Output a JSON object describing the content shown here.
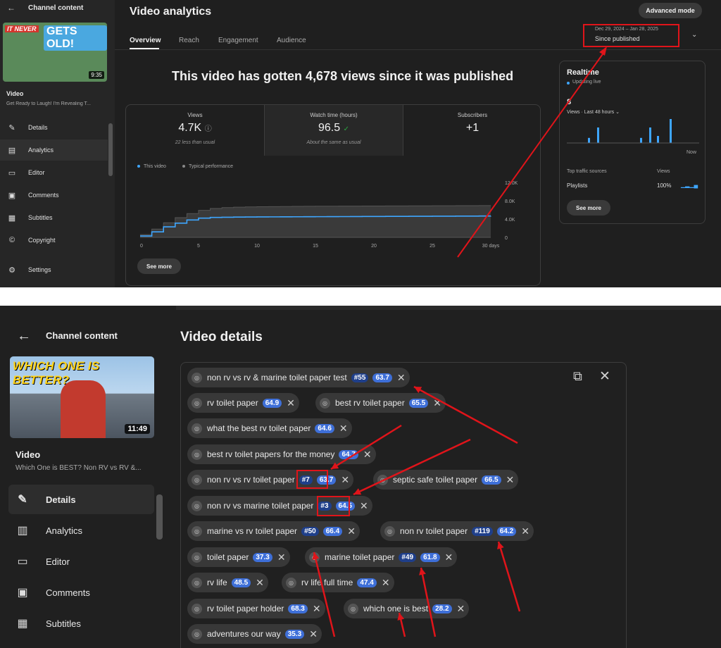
{
  "top": {
    "sidebar": {
      "back_icon": "arrow-left-icon",
      "channel_title": "Channel content",
      "thumb_text_left": "IT NEVER",
      "thumb_text_right": "GETS OLD!",
      "thumb_duration": "9:35",
      "video_label": "Video",
      "video_title": "Get Ready to Laugh! I'm Revealing T...",
      "nav": [
        {
          "label": "Details",
          "icon": "pencil-icon"
        },
        {
          "label": "Analytics",
          "icon": "analytics-icon",
          "active": true
        },
        {
          "label": "Editor",
          "icon": "editor-icon"
        },
        {
          "label": "Comments",
          "icon": "comments-icon"
        },
        {
          "label": "Subtitles",
          "icon": "subtitles-icon"
        },
        {
          "label": "Copyright",
          "icon": "copyright-icon"
        },
        {
          "label": "Settings",
          "icon": "gear-icon"
        }
      ]
    },
    "title": "Video analytics",
    "advanced_mode": "Advanced mode",
    "tabs": [
      "Overview",
      "Reach",
      "Engagement",
      "Audience"
    ],
    "date_range": "Dec 29, 2024 – Jan 28, 2025",
    "date_period": "Since published",
    "headline": "This video has gotten 4,678 views since it was published",
    "metrics": [
      {
        "label": "Views",
        "value": "4.7K",
        "sub": "22 less than usual"
      },
      {
        "label": "Watch time (hours)",
        "value": "96.5",
        "sub": "About the same as usual"
      },
      {
        "label": "Subscribers",
        "value": "+1",
        "sub": ""
      }
    ],
    "legend": {
      "this_video": "This video",
      "typical": "Typical performance"
    },
    "see_more": "See more",
    "realtime": {
      "title": "Realtime",
      "updating": "Updating live",
      "count": "8",
      "views_label": "Views · Last 48 hours",
      "now": "Now",
      "th_source": "Top traffic sources",
      "th_views": "Views",
      "source": "Playlists",
      "percent": "100%",
      "see_more": "See more",
      "bars": [
        0.18,
        0.55,
        0.18,
        0.55,
        0.25,
        0.85
      ]
    }
  },
  "chart_data": {
    "type": "line",
    "x": [
      0,
      1,
      2,
      3,
      4,
      5,
      6,
      7,
      8,
      9,
      10,
      11,
      12,
      13,
      14,
      15,
      16,
      17,
      18,
      19,
      20,
      21,
      22,
      23,
      24,
      25,
      26,
      27,
      28,
      29,
      30
    ],
    "series": [
      {
        "name": "This video",
        "values": [
          300,
          1200,
          2300,
          3100,
          3800,
          4200,
          4350,
          4400,
          4430,
          4450,
          4470,
          4480,
          4490,
          4500,
          4510,
          4520,
          4530,
          4540,
          4550,
          4560,
          4570,
          4580,
          4590,
          4600,
          4610,
          4620,
          4630,
          4640,
          4650,
          4660,
          4678
        ]
      },
      {
        "name": "Typical performance",
        "values": [
          600,
          1800,
          3200,
          4300,
          5200,
          5900,
          6300,
          6500,
          6600,
          6650,
          6700,
          6720,
          6740,
          6760,
          6780,
          6800,
          6810,
          6820,
          6830,
          6840,
          6850,
          6860,
          6870,
          6880,
          6890,
          6900,
          6910,
          6920,
          6930,
          6940,
          6950
        ]
      }
    ],
    "xticks": [
      "0",
      "5",
      "10",
      "15",
      "20",
      "25",
      "30 days"
    ],
    "yticks": [
      "0",
      "4.0K",
      "8.0K",
      "12.0K"
    ],
    "xlim": [
      0,
      30
    ],
    "ylim": [
      0,
      12000
    ],
    "grid": false
  },
  "bottom": {
    "sidebar": {
      "back_icon": "arrow-left-icon",
      "channel_title": "Channel content",
      "thumb_text": "WHICH ONE IS BETTER?",
      "thumb_duration": "11:49",
      "video_label": "Video",
      "video_title": "Which One is BEST? Non RV vs RV &...",
      "nav": [
        {
          "label": "Details",
          "icon": "pencil-icon",
          "active": true
        },
        {
          "label": "Analytics",
          "icon": "analytics-icon"
        },
        {
          "label": "Editor",
          "icon": "editor-icon"
        },
        {
          "label": "Comments",
          "icon": "comments-icon"
        },
        {
          "label": "Subtitles",
          "icon": "subtitles-icon"
        }
      ]
    },
    "title": "Video details",
    "tags": [
      {
        "text": "non rv vs rv & marine toilet paper test",
        "score": "63.7",
        "rank": "#55"
      },
      {
        "text": "rv toilet paper",
        "score": "64.9",
        "rank": ""
      },
      {
        "text": "best rv toilet paper",
        "score": "65.5",
        "rank": ""
      },
      {
        "text": "what the best rv toilet paper",
        "score": "64.6",
        "rank": ""
      },
      {
        "text": "best rv toilet papers for the money",
        "score": "64.7",
        "rank": ""
      },
      {
        "text": "non rv vs rv toilet paper",
        "score": "63.7",
        "rank": "#7"
      },
      {
        "text": "septic safe toilet paper",
        "score": "66.5",
        "rank": ""
      },
      {
        "text": "non rv vs marine toilet paper",
        "score": "64.5",
        "rank": "#3"
      },
      {
        "text": "marine vs rv toilet paper",
        "score": "66.4",
        "rank": "#50"
      },
      {
        "text": "non rv toilet paper",
        "score": "64.2",
        "rank": "#119"
      },
      {
        "text": "toilet paper",
        "score": "37.3",
        "rank": ""
      },
      {
        "text": "marine toilet paper",
        "score": "61.8",
        "rank": "#49"
      },
      {
        "text": "rv life",
        "score": "48.5",
        "rank": ""
      },
      {
        "text": "rv life full time",
        "score": "47.4",
        "rank": ""
      },
      {
        "text": "rv toilet paper holder",
        "score": "68.3",
        "rank": ""
      },
      {
        "text": "which one is best",
        "score": "28.2",
        "rank": ""
      },
      {
        "text": "adventures our way",
        "score": "35.3",
        "rank": ""
      }
    ]
  },
  "colors": {
    "accent_blue": "#3ea6ff",
    "score_blue": "#3e6fd8",
    "rank_blue": "#1f3f8a",
    "annotation_red": "#e0141a"
  }
}
